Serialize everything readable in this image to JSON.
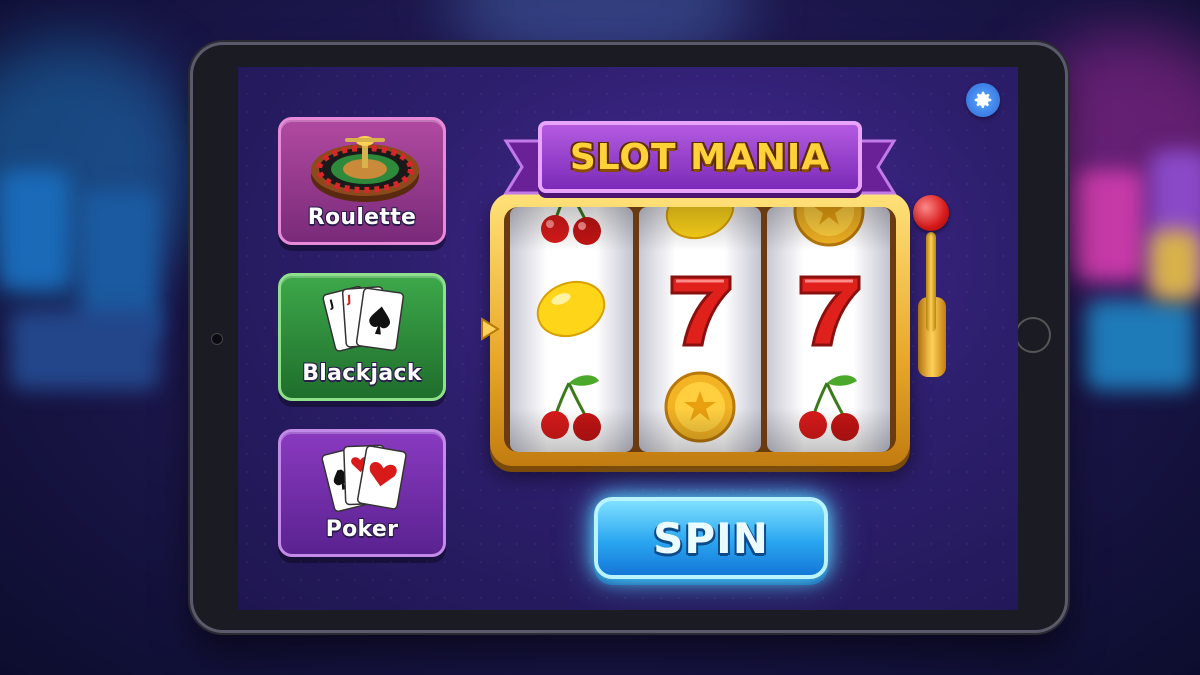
{
  "header": {
    "title": "SLOT MANIA",
    "settings_icon": "gear-icon"
  },
  "games": [
    {
      "label": "Roulette",
      "icon": "roulette-wheel-icon",
      "color": "#9a3a90"
    },
    {
      "label": "Blackjack",
      "icon": "playing-cards-icon",
      "color": "#2f8a3a"
    },
    {
      "label": "Poker",
      "icon": "poker-cards-icon",
      "color": "#7a32b0"
    }
  ],
  "reels": [
    {
      "top": "cherry",
      "middle": "lemon",
      "bottom": "cherry"
    },
    {
      "top": "lemon",
      "middle": "seven",
      "bottom": "coin"
    },
    {
      "top": "coin",
      "middle": "seven",
      "bottom": "cherry"
    }
  ],
  "spin": {
    "label": "SPIN"
  },
  "colors": {
    "accent_gold": "#ffd23a",
    "banner_purple": "#9b3fd0",
    "spin_blue": "#2aa6f0"
  }
}
